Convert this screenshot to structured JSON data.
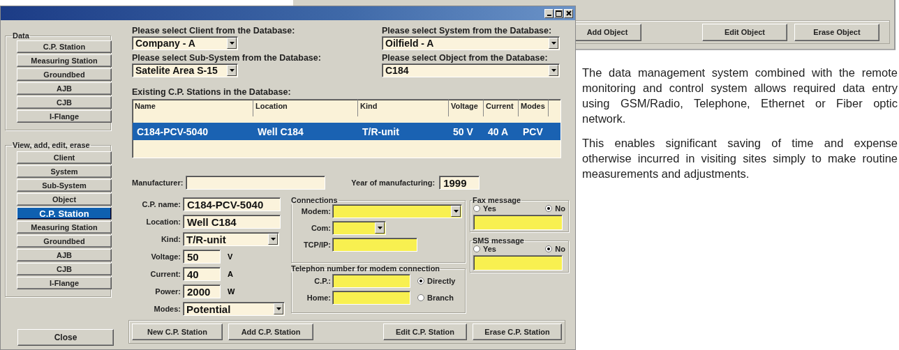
{
  "back_window": {
    "buttons": [
      "Add Object",
      "Edit Object",
      "Erase Object"
    ]
  },
  "window": {
    "data_group": {
      "title": "Data",
      "buttons": [
        "C.P. Station",
        "Measuring Station",
        "Groundbed",
        "AJB",
        "CJB",
        "I-Flange"
      ]
    },
    "view_group": {
      "title": "View, add, edit, erase",
      "buttons": [
        {
          "label": "Client",
          "selected": false
        },
        {
          "label": "System",
          "selected": false
        },
        {
          "label": "Sub-System",
          "selected": false
        },
        {
          "label": "Object",
          "selected": false
        },
        {
          "label": "C.P. Station",
          "selected": true
        },
        {
          "label": "Measuring Station",
          "selected": false
        },
        {
          "label": "Groundbed",
          "selected": false
        },
        {
          "label": "AJB",
          "selected": false
        },
        {
          "label": "CJB",
          "selected": false
        },
        {
          "label": "I-Flange",
          "selected": false
        }
      ]
    },
    "close_button": "Close",
    "selectors": [
      {
        "label": "Please select Client from the Database:",
        "value": "Company - A"
      },
      {
        "label": "Please select System from the Database:",
        "value": "Oilfield - A"
      },
      {
        "label": "Please select Sub-System from the Database:",
        "value": "Satelite Area S-15"
      },
      {
        "label": "Please select Object from the Database:",
        "value": "C184"
      }
    ],
    "table": {
      "title": "Existing C.P. Stations  in the Database:",
      "columns": [
        "Name",
        "Location",
        "Kind",
        "Voltage",
        "Current",
        "Modes"
      ],
      "rows": [
        {
          "cells": [
            "C184-PCV-5040",
            "Well C184",
            "T/R-unit",
            "50 V",
            "40 A",
            "PCV"
          ],
          "selected": true
        }
      ]
    },
    "manufacturer": {
      "label": "Manufacturer:"
    },
    "year": {
      "label": "Year of manufacturing:",
      "value": "1999"
    },
    "station_fields": [
      {
        "kind": "text",
        "label": "C.P. name:",
        "value": "C184-PCV-5040"
      },
      {
        "kind": "text",
        "label": "Location:",
        "value": "Well C184"
      },
      {
        "kind": "select",
        "label": "Kind:",
        "value": "T/R-unit"
      },
      {
        "kind": "unit",
        "label": "Voltage:",
        "value": "50",
        "unit": "V"
      },
      {
        "kind": "unit",
        "label": "Current:",
        "value": "40",
        "unit": "A"
      },
      {
        "kind": "unit",
        "label": "Power:",
        "value": "2000",
        "unit": "W"
      },
      {
        "kind": "select",
        "label": "Modes:",
        "value": "Potential"
      }
    ],
    "connections": {
      "title": "Connections",
      "fields": [
        {
          "kind": "select",
          "label": "Modem:"
        },
        {
          "kind": "short-select",
          "label": "Com:"
        },
        {
          "kind": "text",
          "label": "TCP/IP:"
        }
      ]
    },
    "telephone": {
      "title": "Telephon number for modem connection",
      "fields": [
        {
          "label": "C.P.:",
          "option": {
            "label": "Directly",
            "selected": true
          }
        },
        {
          "label": "Home:",
          "option": {
            "label": "Branch",
            "selected": false
          }
        }
      ]
    },
    "messages": [
      {
        "title": "Fax message",
        "options": [
          {
            "label": "Yes",
            "selected": false
          },
          {
            "label": "No",
            "selected": true
          }
        ]
      },
      {
        "title": "SMS message",
        "options": [
          {
            "label": "Yes",
            "selected": false
          },
          {
            "label": "No",
            "selected": true
          }
        ]
      }
    ],
    "actions": [
      "New C.P. Station",
      "Add C.P. Station",
      "Edit C.P. Station",
      "Erase C.P. Station"
    ]
  },
  "description": [
    "The data management system combined with the remote monitoring and control system allows required data entry using GSM/Radio, Telephone, Ethernet or Fiber optic network.",
    "This enables significant saving of time and expense otherwise incurred in visiting sites simply to make routine measurements and adjustments."
  ]
}
